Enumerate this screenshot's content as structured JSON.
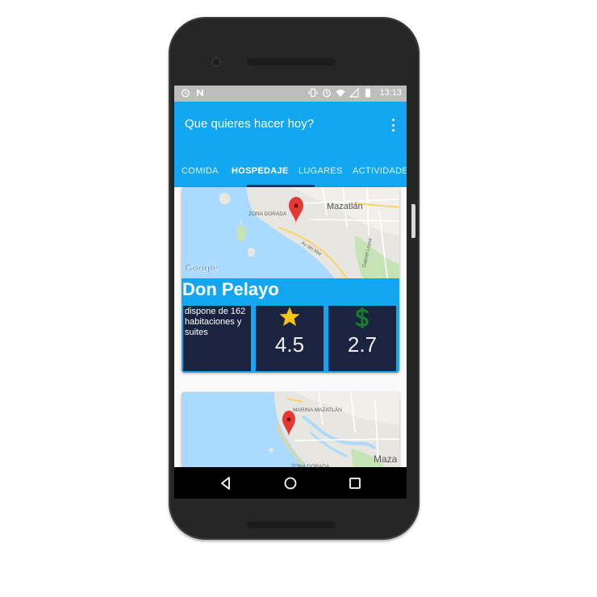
{
  "statusbar": {
    "time": "13:13",
    "left_icons": [
      "alarm-icon",
      "n-logo-icon"
    ],
    "right_icons": [
      "vibrate-icon",
      "alarm-icon",
      "wifi-icon",
      "signal-icon",
      "battery-icon"
    ]
  },
  "appbar": {
    "title": "Que quieres hacer hoy?",
    "menu_icon": "more-vert-icon",
    "color": "#12a7f0"
  },
  "tabs": [
    {
      "label": "COMIDA",
      "active": false
    },
    {
      "label": "HOSPEDAJE",
      "active": true
    },
    {
      "label": "LUGARES",
      "active": false
    },
    {
      "label": "ACTIVIDADES",
      "active": false
    }
  ],
  "cards": [
    {
      "map": {
        "city_label": "Mazatlán",
        "zone_label": "ZONA DORADA",
        "street_label": "Av del Mar",
        "street2_label": "Gabriel Leyva",
        "brand": "Google",
        "marker_icon": "map-marker-icon"
      },
      "title": "Don Pelayo",
      "description": "dispone de 162 habitaciones y suites",
      "rating": {
        "icon": "star-icon",
        "value": "4.5"
      },
      "price": {
        "icon": "dollar-icon",
        "value": "2.7"
      }
    },
    {
      "map": {
        "marina_label": "MARINA MAZATLÁN",
        "zone_label": "ZONA DORADA",
        "city_label": "Maza",
        "marker_icon": "map-marker-icon"
      }
    }
  ],
  "navbar": {
    "back_icon": "back-triangle-icon",
    "home_icon": "home-circle-icon",
    "recents_icon": "recents-square-icon"
  },
  "colors": {
    "accent": "#12a7f0",
    "tab_indicator": "#0d3e72",
    "panel": "#1a2440",
    "star": "#f5c518",
    "dollar": "#1b7a2c",
    "marker": "#e53935",
    "water": "#aadaff",
    "land": "#e8e6e1"
  }
}
